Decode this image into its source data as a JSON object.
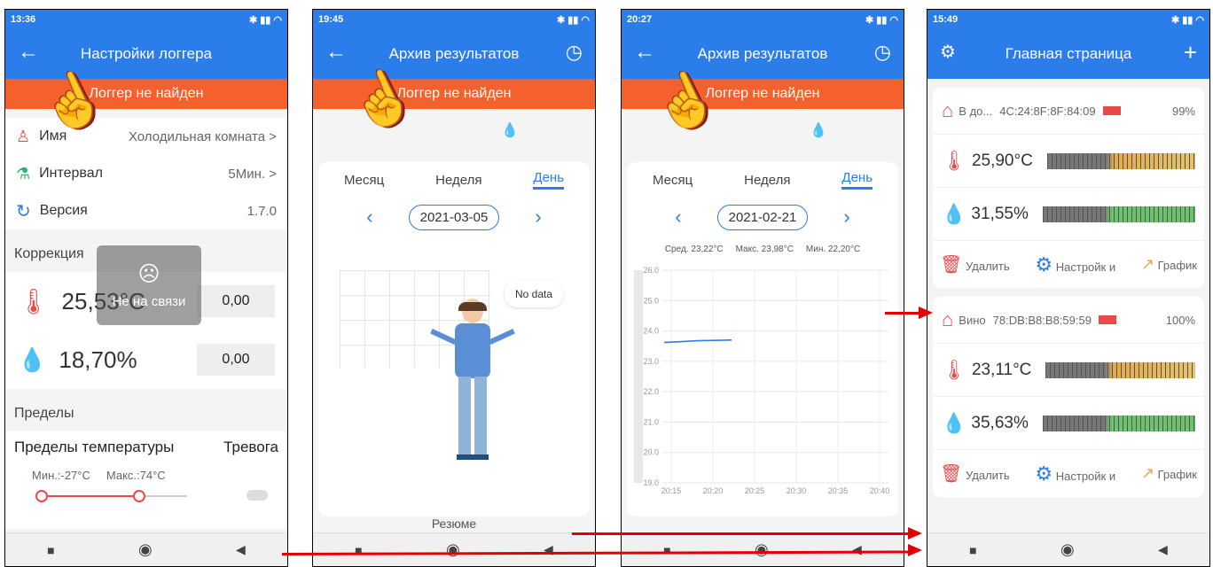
{
  "colors": {
    "primary": "#2b7de9",
    "alert": "#f5612d",
    "arrow": "#e40000",
    "hand": "#f7d400"
  },
  "s1": {
    "time": "13:36",
    "title": "Настройки логгера",
    "banner": "Логгер не найден",
    "name_label": "Имя",
    "name_value": "Холодильная комната >",
    "interval_label": "Интервал",
    "interval_value": "5Мин. >",
    "version_label": "Версия",
    "version_value": "1.7.0",
    "correction": "Коррекция",
    "temp": "25,53°C",
    "temp_corr": "0,00",
    "hum": "18,70%",
    "hum_corr": "0,00",
    "toast": "Не на связи",
    "limits": "Пределы",
    "temp_limits": "Пределы температуры",
    "alarm": "Тревога",
    "min": "Мин.:-27°C",
    "max": "Макс.:74°C"
  },
  "s2": {
    "time": "19:45",
    "title": "Архив результатов",
    "banner": "Логгер не найден",
    "tab_month": "Месяц",
    "tab_week": "Неделя",
    "tab_day": "День",
    "date": "2021-03-05",
    "nodata": "No data",
    "summary": "Резюме"
  },
  "s3": {
    "time": "20:27",
    "title": "Архив результатов",
    "banner": "Логгер не найден",
    "tab_month": "Месяц",
    "tab_week": "Неделя",
    "tab_day": "День",
    "date": "2021-02-21",
    "avg_label": "Сред.",
    "avg": "23,22°C",
    "max_label": "Макс.",
    "max": "23,98°C",
    "min_label": "Мин.",
    "min": "22,20°C"
  },
  "s4": {
    "time": "15:49",
    "title": "Главная страница",
    "dev1_name": "В до...",
    "dev1_mac": "4C:24:8F:8F:84:09",
    "dev1_batt": "99%",
    "dev1_temp": "25,90°C",
    "dev1_hum": "31,55%",
    "dev2_name": "Вино",
    "dev2_mac": "78:DB:B8:B8:59:59",
    "dev2_batt": "100%",
    "dev2_temp": "23,11°C",
    "dev2_hum": "35,63%",
    "delete": "Удалить",
    "settings": "Настройк и",
    "graph": "График"
  },
  "chart_data": {
    "type": "line",
    "x": [
      "20:15",
      "20:20",
      "20:25",
      "20:30",
      "20:35",
      "20:40"
    ],
    "ylim": [
      19.0,
      26.0
    ],
    "yticks": [
      "26.0",
      "25.0",
      "24.0",
      "23.0",
      "22.0",
      "21.0",
      "20.0",
      "19.0"
    ],
    "series": [
      {
        "values": [
          23.62,
          23.68,
          23.7
        ]
      }
    ]
  }
}
